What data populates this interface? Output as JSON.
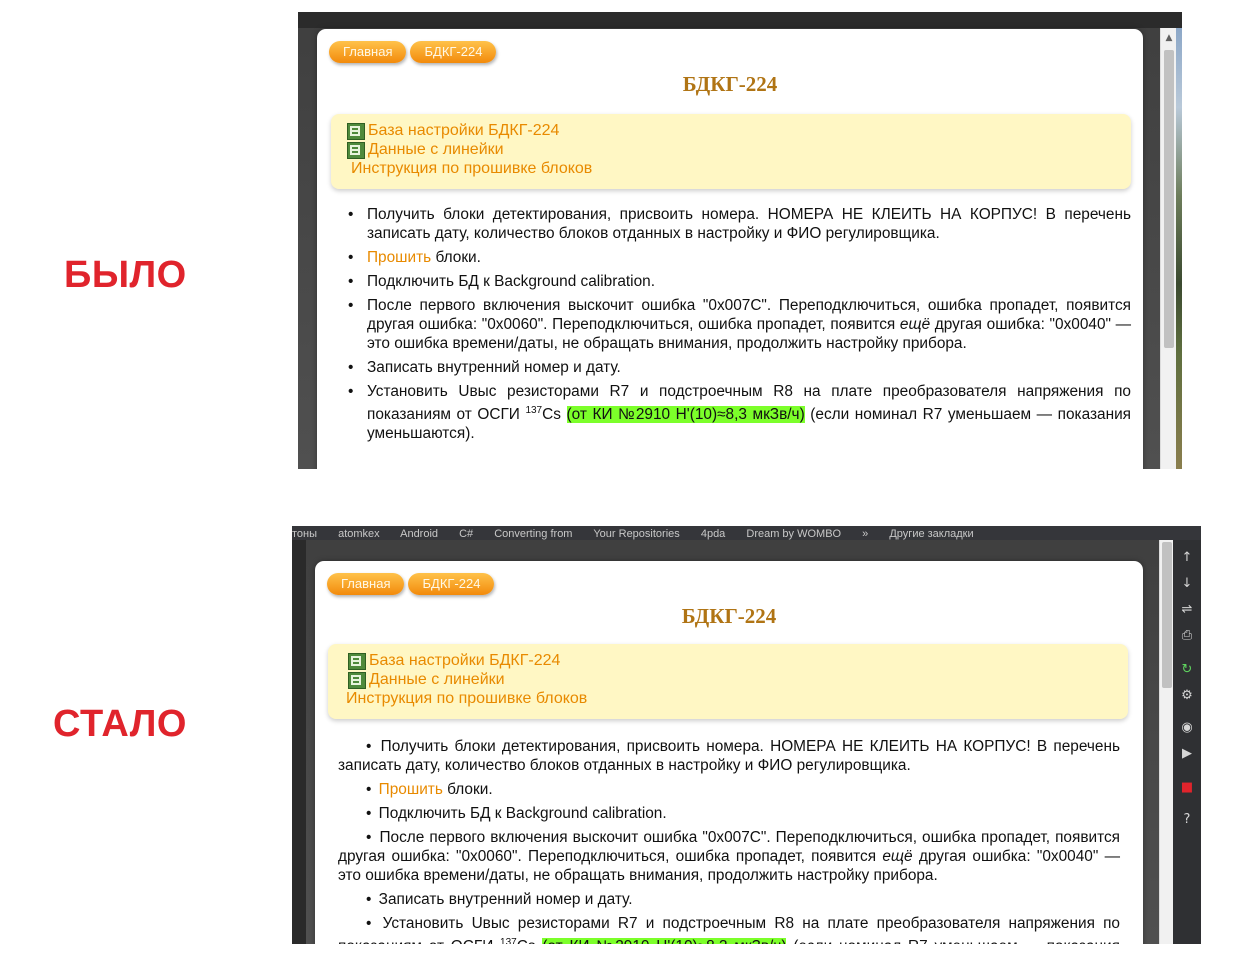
{
  "labels": {
    "before": "БЫЛО",
    "after": "СТАЛО"
  },
  "page": {
    "breadcrumbs": [
      "Главная",
      "БДКГ-224"
    ],
    "title": "БДКГ-224",
    "docs": [
      {
        "label": "База настройки БДКГ-224",
        "icon": "spreadsheet-icon"
      },
      {
        "label": "Данные с линейки",
        "icon": "spreadsheet-icon"
      },
      {
        "label": "Инструкция по прошивке блоков",
        "icon": ""
      }
    ],
    "steps": [
      {
        "text": "Получить блоки детектирования, присвоить номера. НОМЕРА НЕ КЛЕИТЬ НА КОРПУС! В перечень записать дату, количество блоков отданных в настройку и ФИО регулировщика."
      },
      {
        "link": "Прошить",
        "text": " блоки."
      },
      {
        "text": "Подключить БД к Background calibration."
      },
      {
        "pre": "После первого включения выскочит ошибка \"0x007C\". Переподключиться, ошибка пропадет, появится другая ошибка: \"0x0060\". Переподключиться, ошибка пропадет, появится ",
        "em": "ещё",
        "post": " другая ошибка: \"0x0040\" — это ошибка времени/даты, не обращать внимания, продолжить настройку прибора."
      },
      {
        "text": "Записать внутренний номер и дату."
      },
      {
        "pre": "Установить Uвыс резисторами R7 и подстроечным R8 на плате преобразователя напряжения по показаниям от ОСГИ ",
        "sup": "137",
        "iso": "Cs",
        "highlight": "(от КИ №2910 H'(10)≈8,3 мкЗв/ч)",
        "post": " (если номинал R7 уменьшаем — показания уменьшаются)."
      }
    ],
    "bullet": "•"
  },
  "browser_after": {
    "bookmarks": [
      "тоны",
      "atomkex",
      "Android",
      "C#",
      "Converting from",
      "Your Repositories",
      "4pda",
      "Dream by WOMBO",
      "»",
      "Другие закладки"
    ],
    "tools": [
      "↑",
      "↓",
      "⇌",
      "⎙",
      "↻",
      "⚙",
      "◉",
      "▶",
      "■",
      "?"
    ]
  },
  "colors": {
    "accent_orange": "#e88a00",
    "label_red": "#e0242c",
    "title_brown": "#b07414",
    "highlight": "#7cff2a"
  }
}
